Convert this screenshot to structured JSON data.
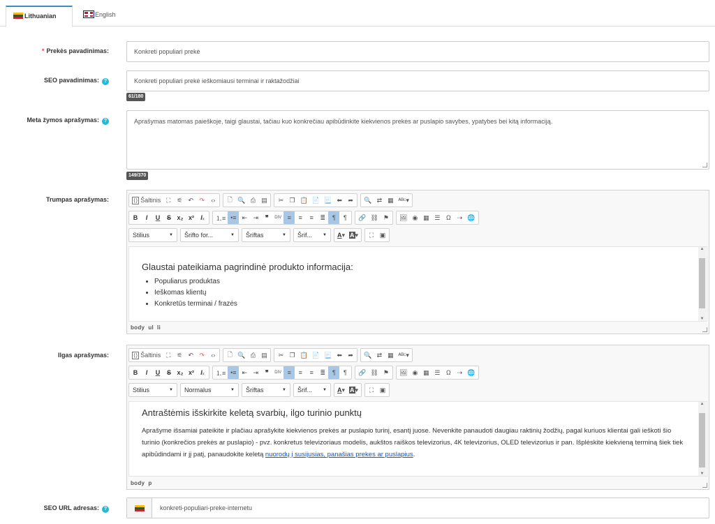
{
  "tabs": [
    {
      "label": "Lithuanian",
      "flag": "lt-flag-icon"
    },
    {
      "label": "English",
      "flag": "gb-flag-icon"
    }
  ],
  "fields": {
    "product_name": {
      "label": "Prekės pavadinimas:",
      "required": "*",
      "value": "Konkreti populiari prekė"
    },
    "seo_name": {
      "label": "SEO pavadinimas:",
      "value": "Konkreti populiari prekė ieškomiausi terminai ir raktažodžiai",
      "counter": "61/180"
    },
    "meta": {
      "label": "Meta žymos aprašymas:",
      "value": "Aprašymas matomas paieškoje, taigi glaustai, tačiau kuo konkrečiau apibūdinkite kiekvienos prekės ar puslapio savybes, ypatybes bei kitą informaciją.",
      "counter": "149/370"
    },
    "short_desc": {
      "label": "Trumpas aprašymas:"
    },
    "long_desc": {
      "label": "Ilgas aprašymas:"
    },
    "seo_url": {
      "label": "SEO URL adresas:",
      "value": "konkreti-populiari-preke-internetu"
    }
  },
  "editor": {
    "source_label": "Šaltinis",
    "style_label": "Stilius",
    "font_label": "Šriftas",
    "size_label": "Šrif...",
    "format_short": "Šrifto for...",
    "format_long": "Normalus"
  },
  "short_content": {
    "heading": "Glaustai pateikiama pagrindinė produkto informacija:",
    "items": [
      "Populiarus produktas",
      "Ieškomas klientų",
      "Konkretūs terminai / frazės"
    ],
    "path": [
      "body",
      "ul",
      "li"
    ]
  },
  "long_content": {
    "heading": "Antraštėmis išskirkite keletą svarbių, ilgo turinio punktų",
    "para": "Aprašyme išsamiai pateikite ir plačiau aprašykite kiekvienos prekės ar puslapio turinį, esantį juose. Nevenkite panaudoti daugiau raktinių žodžių, pagal kuriuos klientai gali ieškoti šio turinio (konkrečios prekės ar puslapio) - pvz. konkretus televizoriaus modelis, aukštos raiškos televizorius, 4K televizorius, OLED televizorius ir pan. Išplėskite kiekvieną terminą šiek tiek apibūdindami ir jį patį, panaudokite keletą",
    "link": "nuorodų į susijusias, panašias prekes ar puslapius",
    "end": ".",
    "path": [
      "body",
      "p"
    ]
  },
  "colors": {
    "accent": "#3c8dbc",
    "required": "#e04c4c",
    "help": "#25b9d7",
    "link": "#1155cc",
    "active_btn": "#a8c7e6"
  }
}
